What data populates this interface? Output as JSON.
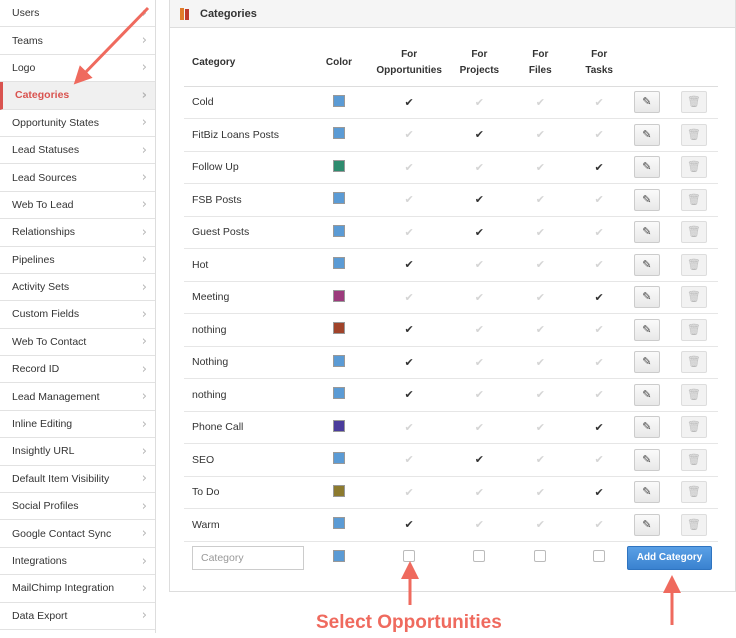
{
  "sidebar": {
    "items": [
      {
        "label": "Users"
      },
      {
        "label": "Teams"
      },
      {
        "label": "Logo"
      },
      {
        "label": "Categories",
        "active": true
      },
      {
        "label": "Opportunity States"
      },
      {
        "label": "Lead Statuses"
      },
      {
        "label": "Lead Sources"
      },
      {
        "label": "Web To Lead"
      },
      {
        "label": "Relationships"
      },
      {
        "label": "Pipelines"
      },
      {
        "label": "Activity Sets"
      },
      {
        "label": "Custom Fields"
      },
      {
        "label": "Web To Contact"
      },
      {
        "label": "Record ID"
      },
      {
        "label": "Lead Management"
      },
      {
        "label": "Inline Editing"
      },
      {
        "label": "Insightly URL"
      },
      {
        "label": "Default Item Visibility"
      },
      {
        "label": "Social Profiles"
      },
      {
        "label": "Google Contact Sync"
      },
      {
        "label": "Integrations"
      },
      {
        "label": "MailChimp Integration"
      },
      {
        "label": "Data Export"
      }
    ],
    "chevron": "›",
    "chevron_icon": "chevron-right-icon"
  },
  "panel": {
    "title": "Categories",
    "title_icon": "categories-icon"
  },
  "table": {
    "headers": {
      "category": "Category",
      "color": "Color",
      "opp_line1": "For",
      "opp_line2": "Opportunities",
      "proj_line1": "For",
      "proj_line2": "Projects",
      "files_line1": "For",
      "files_line2": "Files",
      "tasks_line1": "For",
      "tasks_line2": "Tasks"
    },
    "check_glyph": "✔",
    "edit_glyph": "✎",
    "delete_glyph": "🗑",
    "rows": [
      {
        "name": "Cold",
        "color": "#5b9bd5",
        "opportunities": true,
        "projects": false,
        "files": false,
        "tasks": false
      },
      {
        "name": "FitBiz Loans Posts",
        "color": "#5b9bd5",
        "opportunities": false,
        "projects": true,
        "files": false,
        "tasks": false
      },
      {
        "name": "Follow Up",
        "color": "#2e8b6e",
        "opportunities": false,
        "projects": false,
        "files": false,
        "tasks": true
      },
      {
        "name": "FSB Posts",
        "color": "#5b9bd5",
        "opportunities": false,
        "projects": true,
        "files": false,
        "tasks": false
      },
      {
        "name": "Guest Posts",
        "color": "#5b9bd5",
        "opportunities": false,
        "projects": true,
        "files": false,
        "tasks": false
      },
      {
        "name": "Hot",
        "color": "#5b9bd5",
        "opportunities": true,
        "projects": false,
        "files": false,
        "tasks": false
      },
      {
        "name": "Meeting",
        "color": "#9c3a7c",
        "opportunities": false,
        "projects": false,
        "files": false,
        "tasks": true
      },
      {
        "name": "nothing",
        "color": "#a0432a",
        "opportunities": true,
        "projects": false,
        "files": false,
        "tasks": false
      },
      {
        "name": "Nothing",
        "color": "#5b9bd5",
        "opportunities": true,
        "projects": false,
        "files": false,
        "tasks": false
      },
      {
        "name": "nothing",
        "color": "#5b9bd5",
        "opportunities": true,
        "projects": false,
        "files": false,
        "tasks": false
      },
      {
        "name": "Phone Call",
        "color": "#4a3c9c",
        "opportunities": false,
        "projects": false,
        "files": false,
        "tasks": true
      },
      {
        "name": "SEO",
        "color": "#5b9bd5",
        "opportunities": false,
        "projects": true,
        "files": false,
        "tasks": false
      },
      {
        "name": "To Do",
        "color": "#8c7a2e",
        "opportunities": false,
        "projects": false,
        "files": false,
        "tasks": true
      },
      {
        "name": "Warm",
        "color": "#5b9bd5",
        "opportunities": true,
        "projects": false,
        "files": false,
        "tasks": false
      }
    ],
    "new_row": {
      "placeholder": "Category",
      "color": "#5b9bd5",
      "add_label": "Add Category"
    }
  },
  "annotation": {
    "callout_text": "Select Opportunities",
    "arrow_color": "#ef6a5e"
  }
}
